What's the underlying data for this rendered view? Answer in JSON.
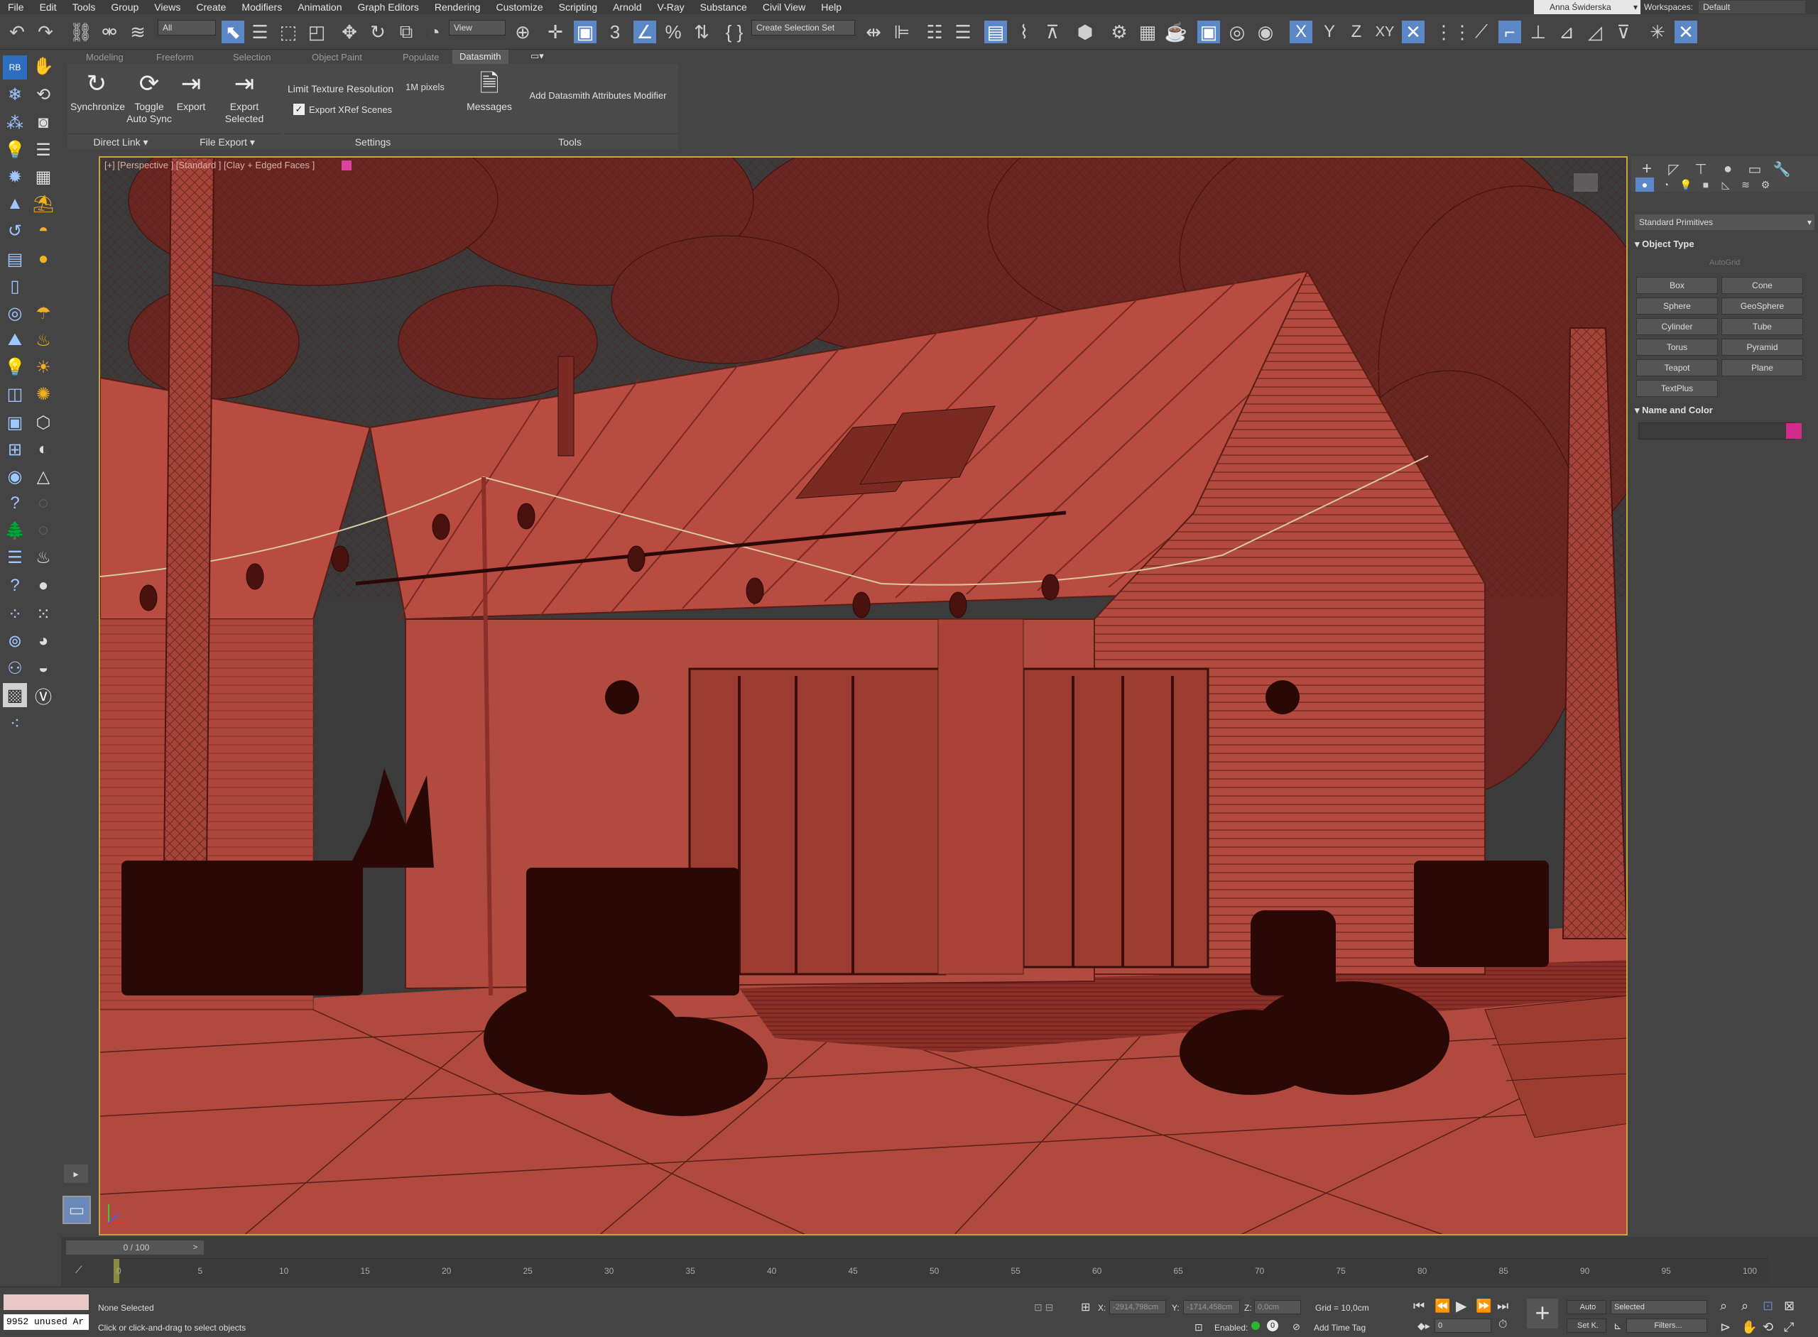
{
  "menu": [
    "File",
    "Edit",
    "Tools",
    "Group",
    "Views",
    "Create",
    "Modifiers",
    "Animation",
    "Graph Editors",
    "Rendering",
    "Customize",
    "Scripting",
    "Arnold",
    "V-Ray",
    "Substance",
    "Civil View",
    "Help"
  ],
  "user": "Anna Świderska",
  "workspaces_label": "Workspaces:",
  "workspace_value": "Default",
  "toolbar": {
    "filter_value": "All",
    "ref_coord": "View",
    "selection_set": "Create Selection Set",
    "axes": [
      "X",
      "Y",
      "Z",
      "XY"
    ]
  },
  "ribbon_tabs": [
    "Modeling",
    "Freeform",
    "Selection",
    "Object Paint",
    "Populate",
    "Datasmith"
  ],
  "ribbon": {
    "synchronize": "Synchronize",
    "toggle_auto_sync": "Toggle Auto Sync",
    "export": "Export",
    "export_selected": "Export Selected",
    "limit_texture": "Limit Texture Resolution",
    "pixels": "1M pixels",
    "export_xref": "Export XRef Scenes",
    "messages": "Messages",
    "add_modifier": "Add Datasmith Attributes Modifier",
    "groups": [
      "Direct Link",
      "File Export",
      "Settings",
      "Tools"
    ]
  },
  "viewport": {
    "label": "[+] [Perspective ] [Standard ] [Clay + Edged Faces ]"
  },
  "command_panel": {
    "dropdown": "Standard Primitives",
    "object_type": "Object Type",
    "autogrid": "AutoGrid",
    "buttons": [
      "Box",
      "Cone",
      "Sphere",
      "GeoSphere",
      "Cylinder",
      "Tube",
      "Torus",
      "Pyramid",
      "Teapot",
      "Plane",
      "TextPlus"
    ],
    "name_color": "Name and Color",
    "color": "#d02a8a"
  },
  "timeline": {
    "slider": "0 / 100",
    "ticks": [
      "0",
      "5",
      "10",
      "15",
      "20",
      "25",
      "30",
      "35",
      "40",
      "45",
      "50",
      "55",
      "60",
      "65",
      "70",
      "75",
      "80",
      "85",
      "90",
      "95",
      "100"
    ]
  },
  "status": {
    "memory": "9952 unused Ar",
    "selection": "None Selected",
    "prompt": "Click or click-and-drag to select objects",
    "x_label": "X:",
    "x": "-2914,798cm",
    "y_label": "Y:",
    "y": "-1714,458cm",
    "z_label": "Z:",
    "z": "0,0cm",
    "grid": "Grid = 10,0cm",
    "enabled": "Enabled:",
    "add_time_tag": "Add Time Tag",
    "auto": "Auto",
    "set_key": "Set K.",
    "key_mode": "Selected",
    "filters": "Filters...",
    "frame": "0"
  }
}
